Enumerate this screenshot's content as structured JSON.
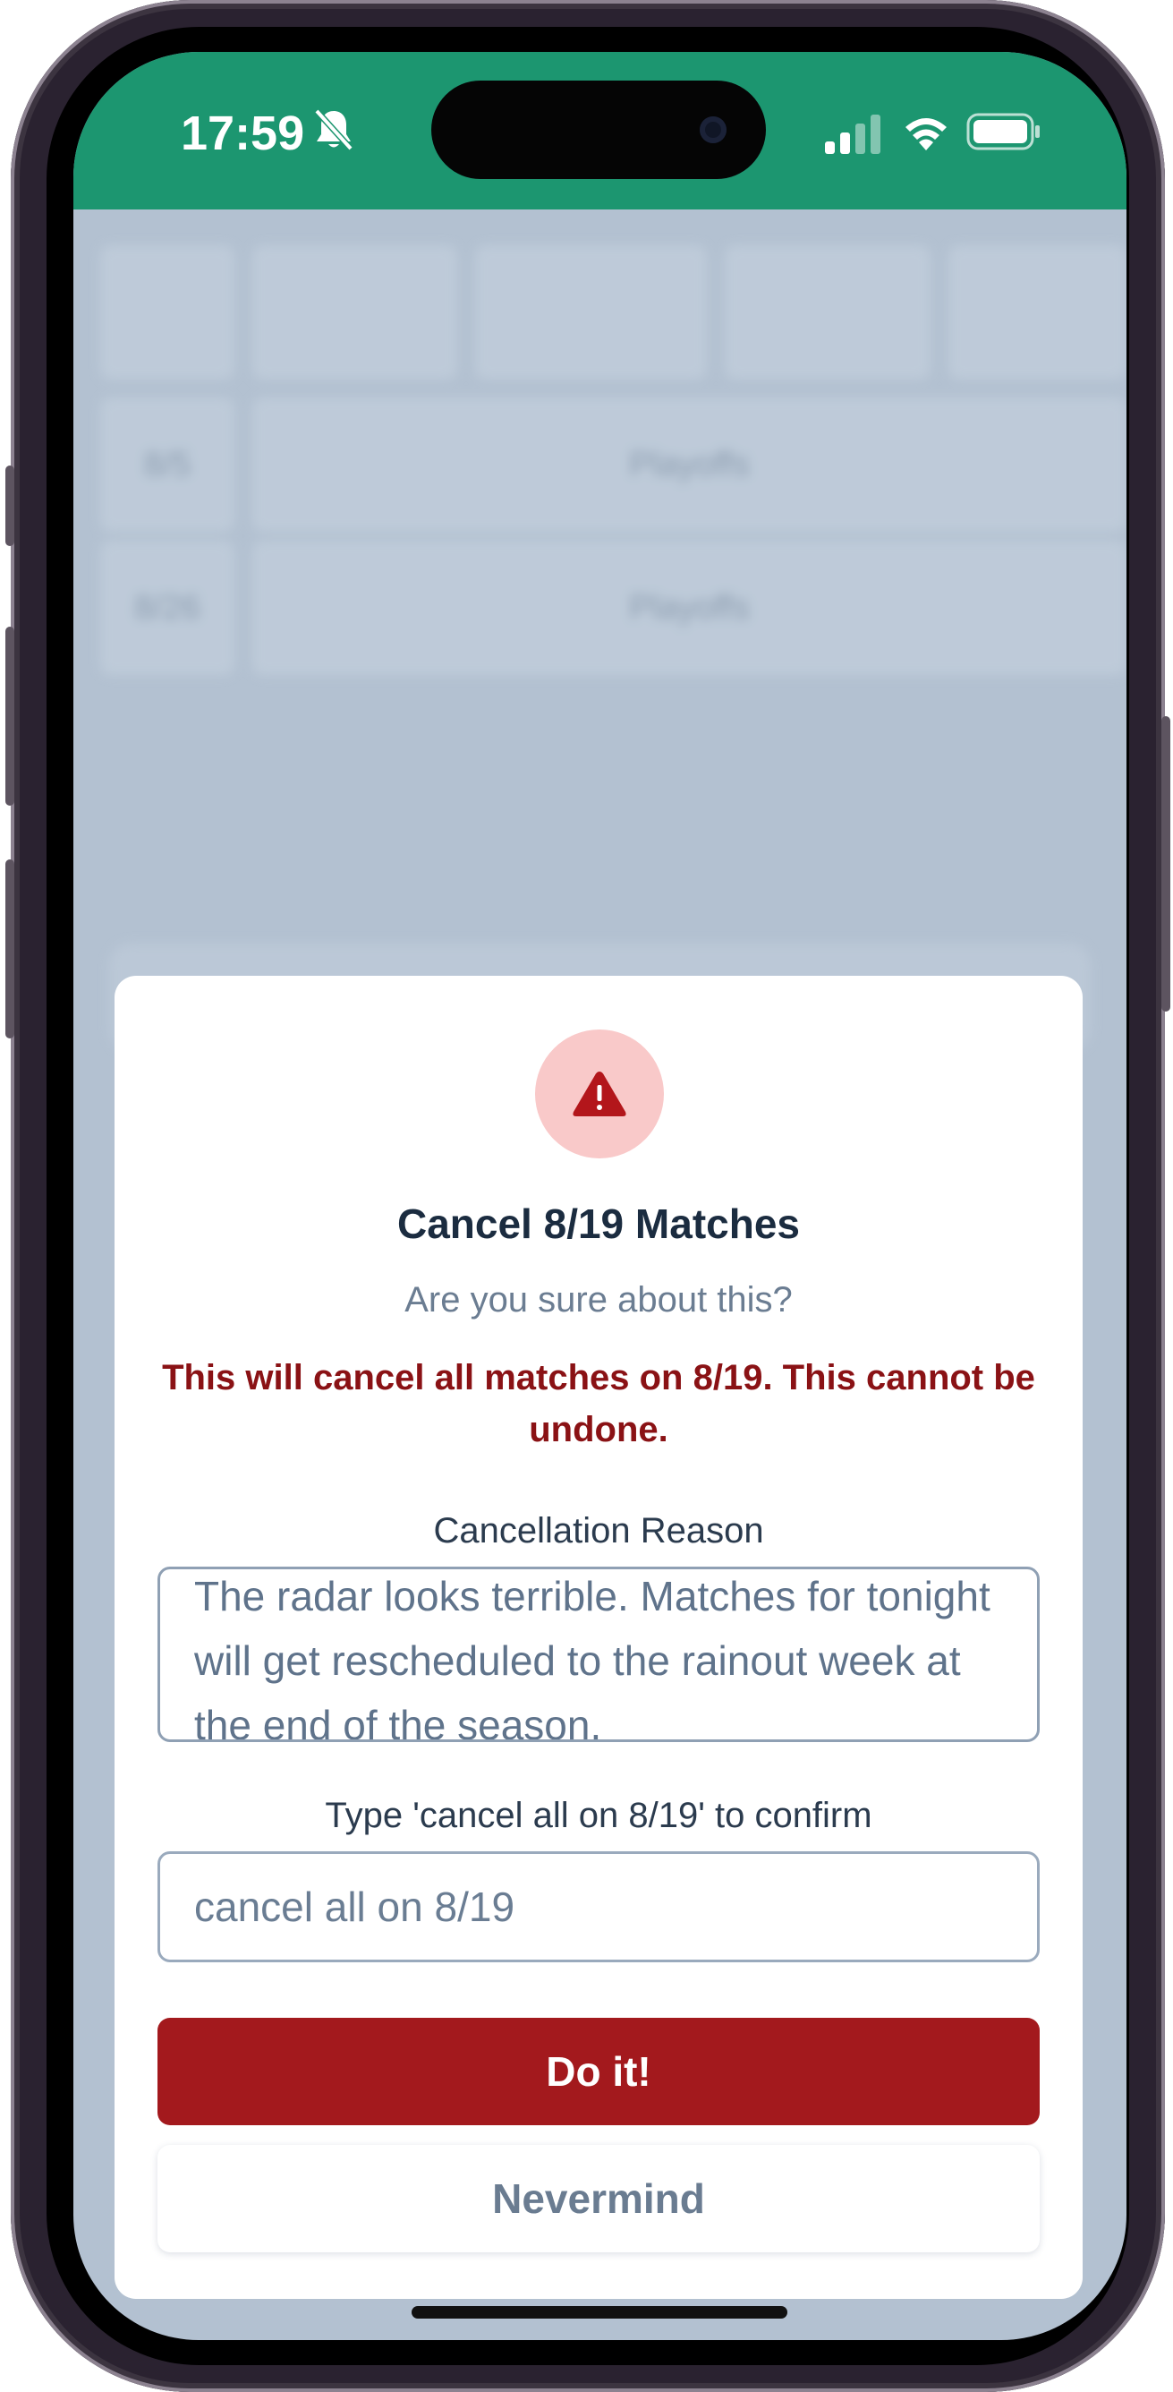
{
  "status_bar": {
    "time": "17:59",
    "icons": [
      "bell-slash-icon",
      "cellular-signal-icon",
      "wifi-icon",
      "battery-icon"
    ]
  },
  "background": {
    "rows": [
      {
        "date": "8/5",
        "label": "Playoffs"
      },
      {
        "date": "8/26",
        "label": "Playoffs"
      }
    ]
  },
  "modal": {
    "icon": "warning-triangle-icon",
    "title": "Cancel 8/19 Matches",
    "subtitle": "Are you sure about this?",
    "warning": "This will cancel all matches on 8/19. This cannot be undone.",
    "reason_label": "Cancellation Reason",
    "reason_value": "The radar looks terrible. Matches for tonight will get rescheduled to the rainout week at the end of the season.",
    "confirm_label": "Type 'cancel all on 8/19' to confirm",
    "confirm_value": "cancel all on 8/19",
    "do_button": "Do it!",
    "cancel_button": "Nevermind"
  },
  "colors": {
    "status_bar": "#1c9670",
    "danger": "#a3191d",
    "warning_text": "#8a1215",
    "icon_bg": "#f9c9c9"
  }
}
